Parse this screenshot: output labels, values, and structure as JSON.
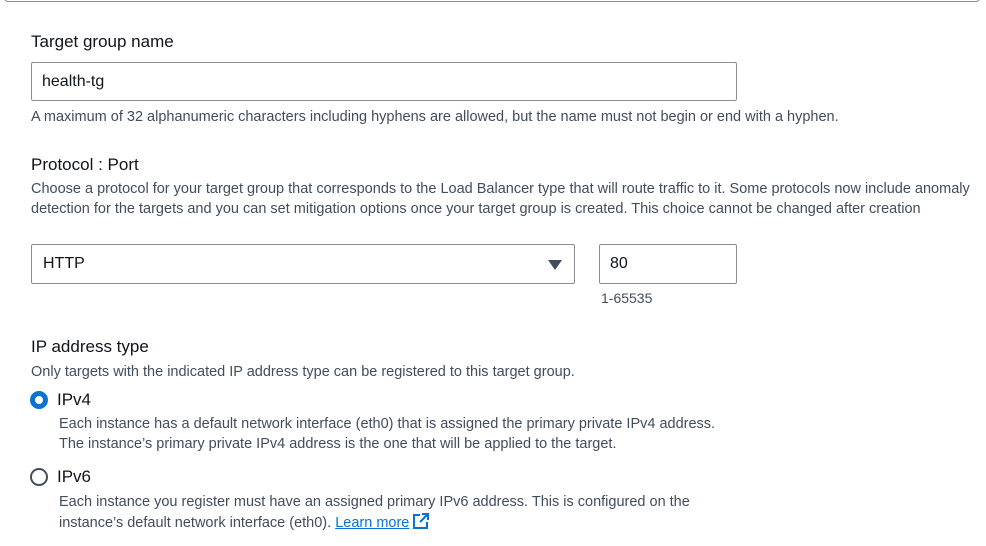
{
  "target_group_name": {
    "label": "Target group name",
    "value": "health-tg",
    "help": "A maximum of 32 alphanumeric characters including hyphens are allowed, but the name must not begin or end with a hyphen."
  },
  "protocol_port": {
    "label": "Protocol : Port",
    "description": "Choose a protocol for your target group that corresponds to the Load Balancer type that will route traffic to it. Some protocols now include anomaly detection for the targets and you can set mitigation options once your target group is created. This choice cannot be changed after creation",
    "protocol_selected": "HTTP",
    "port_value": "80",
    "port_hint": "1-65535"
  },
  "ip_address_type": {
    "label": "IP address type",
    "description": "Only targets with the indicated IP address type can be registered to this target group.",
    "options": [
      {
        "label": "IPv4",
        "selected": true,
        "description": "Each instance has a default network interface (eth0) that is assigned the primary private IPv4 address. The instance’s primary private IPv4 address is the one that will be applied to the target."
      },
      {
        "label": "IPv6",
        "selected": false,
        "description": "Each instance you register must have an assigned primary IPv6 address. This is configured on the instance’s default network interface (eth0).",
        "link_text": "Learn more",
        "link_icon": "external-link-icon"
      }
    ]
  },
  "colors": {
    "accent": "#0972d3",
    "text": "#0f141a",
    "secondary_text": "#414d5c",
    "border": "#8c8c94"
  }
}
